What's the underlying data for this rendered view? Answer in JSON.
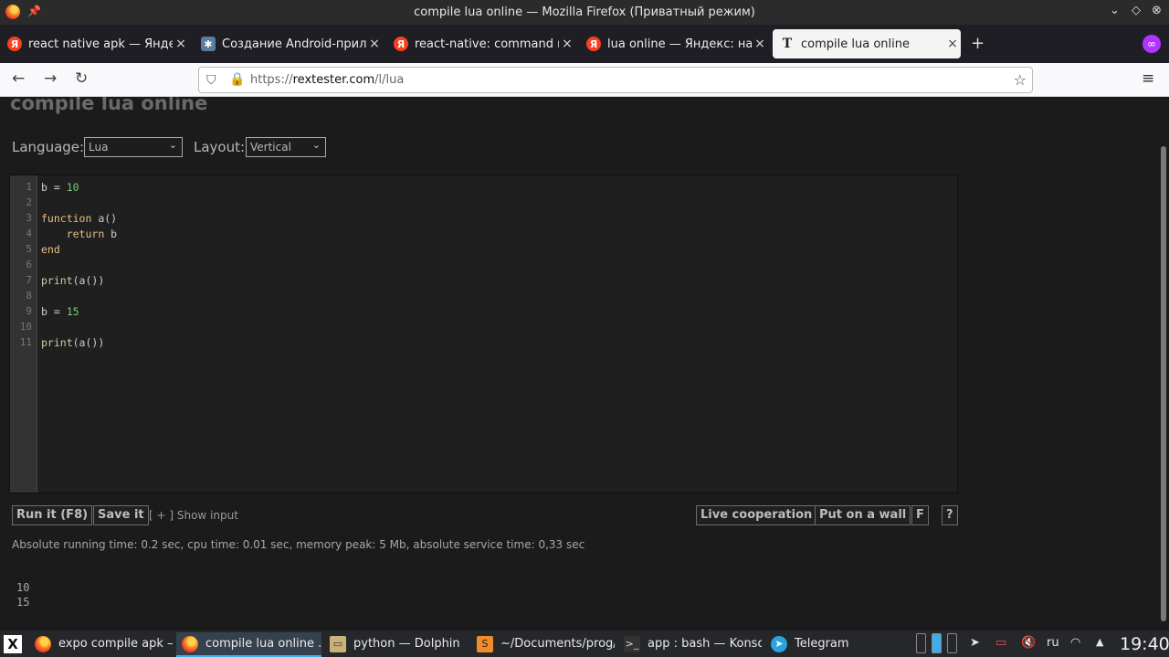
{
  "window": {
    "title": "compile lua online — Mozilla Firefox (Приватный режим)"
  },
  "tabs": [
    {
      "label": "react native apk — Яндекс: н",
      "icon": "yandex-icon",
      "close": "×"
    },
    {
      "label": "Создание Android-приложени",
      "icon": "gear-icon",
      "close": "×"
    },
    {
      "label": "react-native: command not fo",
      "icon": "yandex-icon",
      "close": "×"
    },
    {
      "label": "lua online — Яндекс: нашлось",
      "icon": "yandex-icon",
      "close": "×"
    },
    {
      "label": "compile lua online",
      "icon": "t-icon",
      "close": "×"
    }
  ],
  "toolbar": {
    "new_tab": "+",
    "back": "←",
    "forward": "→",
    "reload": "↻",
    "url_prefix": "https://",
    "url_domain": "rextester.com",
    "url_path": "/l/lua",
    "menu": "≡",
    "star": "☆"
  },
  "page": {
    "title": "compile lua online",
    "language_label": "Language:",
    "language_value": "Lua",
    "layout_label": "Layout:",
    "layout_value": "Vertical",
    "code_lines": [
      "b = 10",
      "",
      "function a()",
      "    return b",
      "end",
      "",
      "print(a())",
      "",
      "b = 15",
      "",
      "print(a())"
    ],
    "line_numbers": [
      "1",
      "2",
      "3",
      "4",
      "5",
      "6",
      "7",
      "8",
      "9",
      "10",
      "11"
    ],
    "buttons": {
      "run": "Run it (F8)",
      "save": "Save it",
      "show_input": "[ + ] Show input",
      "live": "Live cooperation",
      "wall": "Put on a wall",
      "f": "F",
      "help": "?"
    },
    "stats": "Absolute running time: 0.2 sec, cpu time: 0.01 sec, memory peak: 5 Mb, absolute service time: 0,33 sec",
    "output": [
      "10",
      "15"
    ]
  },
  "taskbar": {
    "tasks": [
      {
        "label": "expo compile apk — ...",
        "active": false
      },
      {
        "label": "compile lua online ...",
        "active": true
      },
      {
        "label": "python — Dolphin",
        "active": false
      },
      {
        "label": "~/Documents/prog/...",
        "active": false
      },
      {
        "label": "app : bash — Konsole",
        "active": false
      },
      {
        "label": "Telegram",
        "active": false
      }
    ],
    "lang": "ru",
    "clock": "19:40"
  }
}
